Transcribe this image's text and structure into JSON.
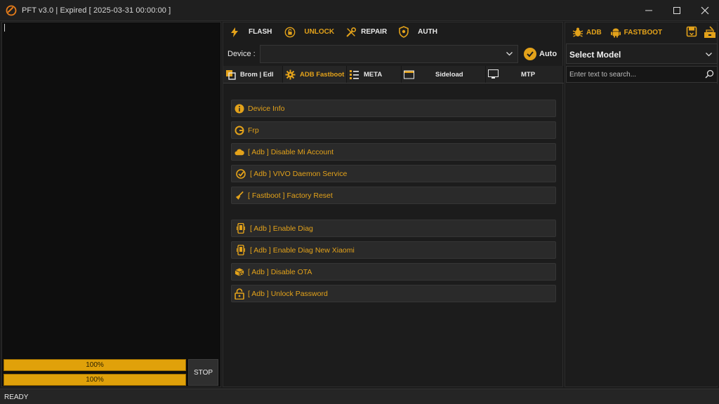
{
  "window": {
    "title": "PFT v3.0   | Expired [ 2025-03-31 00:00:00 ]",
    "controls": [
      "minimize",
      "maximize",
      "close"
    ]
  },
  "log": {
    "progress_top": "100%",
    "progress_bottom": "100%",
    "progress_top_value": 100,
    "progress_bottom_value": 100,
    "stop_label": "STOP"
  },
  "main_tabs": [
    {
      "label": "FLASH",
      "icon": "lightning-icon"
    },
    {
      "label": "UNLOCK",
      "icon": "unlock-icon"
    },
    {
      "label": "REPAIR",
      "icon": "wrench-icon"
    },
    {
      "label": "AUTH",
      "icon": "shield-icon"
    }
  ],
  "device": {
    "label": "Device :",
    "value": "",
    "auto_label": "Auto",
    "auto_checked": true
  },
  "sub_tabs": [
    {
      "label": "Brom | Edl",
      "icon": "chip-icon"
    },
    {
      "label": "ADB Fastboot",
      "icon": "gear-icon"
    },
    {
      "label": "META",
      "icon": "grid-icon"
    },
    {
      "label": "Sideload",
      "icon": "folder-icon"
    },
    {
      "label": "MTP",
      "icon": "monitor-icon"
    }
  ],
  "actions": [
    {
      "label": "Device Info",
      "icon": "info-icon"
    },
    {
      "label": "Frp",
      "icon": "google-icon"
    },
    {
      "label": "[ Adb ] Disable Mi Account",
      "icon": "cloud-icon"
    },
    {
      "label": "[ Adb ] VIVO Daemon Service",
      "icon": "check-icon"
    },
    {
      "label": "[ Fastboot ] Factory Reset",
      "icon": "broom-icon"
    },
    {
      "label": "[ Adb ] Enable Diag",
      "icon": "phone-icon"
    },
    {
      "label": "[ Adb ] Enable Diag  New Xiaomi",
      "icon": "phone-icon"
    },
    {
      "label": "[ Adb ] Disable OTA",
      "icon": "package-icon"
    },
    {
      "label": "[ Adb ] Unlock Password",
      "icon": "padlock-icon"
    }
  ],
  "right": {
    "tabs": [
      {
        "label": "ADB",
        "icon": "bug-icon"
      },
      {
        "label": "FASTBOOT",
        "icon": "android-icon"
      }
    ],
    "extra_icons": [
      "save-icon",
      "toolbox-icon"
    ],
    "model_select": "Select Model",
    "search_placeholder": "Enter text to search..."
  },
  "status": {
    "text": "READY"
  },
  "colors": {
    "accent": "#e3a21a",
    "progress": "#e0a10a",
    "background": "#1c1c1c",
    "log_background": "#0e0e0e"
  }
}
